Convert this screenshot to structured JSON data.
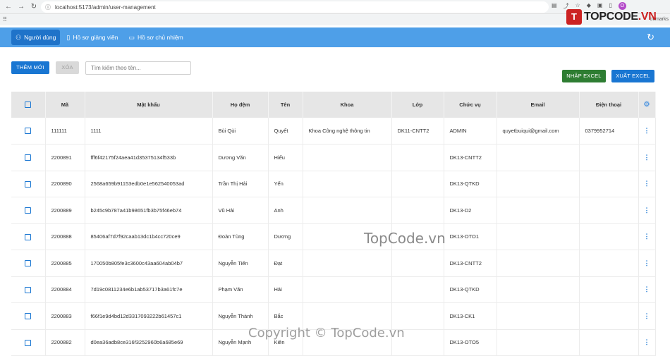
{
  "browser": {
    "url": "localhost:5173/admin/user-management",
    "bookmarks_label": "okmarks",
    "profile_initial": "O"
  },
  "logo": {
    "prefix": "T",
    "text": "TOPCODE",
    "suffix": ".VN"
  },
  "header": {
    "tabs": [
      {
        "label": "Người dùng",
        "icon": "users-icon",
        "active": true
      },
      {
        "label": "Hồ sơ giảng viên",
        "icon": "document-icon",
        "active": false
      },
      {
        "label": "Hồ sơ chủ nhiệm",
        "icon": "folder-icon",
        "active": false
      }
    ],
    "accent": "#4e9fe8"
  },
  "toolbar": {
    "add_label": "THÊM MỚI",
    "delete_label": "XÓA",
    "search_placeholder": "Tìm kiếm theo tên...",
    "import_label": "NHẬP EXCEL",
    "export_label": "XUẤT EXCEL"
  },
  "table": {
    "columns": [
      "Mã",
      "Mật khẩu",
      "Họ đệm",
      "Tên",
      "Khoa",
      "Lớp",
      "Chức vụ",
      "Email",
      "Điện thoại"
    ],
    "rows": [
      [
        "111111",
        "1111",
        "Bùi Qùi",
        "Quyết",
        "Khoa Công nghệ thông tin",
        "DK11-CNTT2",
        "ADMIN",
        "quyetbuiqui@gmail.com",
        "0379952714"
      ],
      [
        "2200891",
        "fff6f42175f24aea41d35375134f533b",
        "Dương Văn",
        "Hiếu",
        "",
        "",
        "DK13-CNTT2",
        "",
        ""
      ],
      [
        "2200890",
        "2568a659b91153edb0e1e562540053ad",
        "Trần Thị Hải",
        "Yến",
        "",
        "",
        "DK13-QTKD",
        "",
        ""
      ],
      [
        "2200889",
        "b245c9b787a41b98651fb3b75f46eb74",
        "Vũ Hải",
        "Anh",
        "",
        "",
        "DK13-D2",
        "",
        ""
      ],
      [
        "2200888",
        "85406af7d7f92caab13dc1b4cc720ce9",
        "Đoàn Tùng",
        "Dương",
        "",
        "",
        "DK13-OTO1",
        "",
        ""
      ],
      [
        "2200885",
        "170050b805fe3c3600c43aa604ab04b7",
        "Nguyễn Tiến",
        "Đạt",
        "",
        "",
        "DK13-CNTT2",
        "",
        ""
      ],
      [
        "2200884",
        "7d19c0811234e6b1ab53717b3a61fc7e",
        "Phạm Văn",
        "Hải",
        "",
        "",
        "DK13-QTKD",
        "",
        ""
      ],
      [
        "2200883",
        "f66f1e9d4bd12d3317093222b61457c1",
        "Nguyễn Thành",
        "Bắc",
        "",
        "",
        "DK13-CK1",
        "",
        ""
      ],
      [
        "2200882",
        "d0ea36adb8ce316f3252960b6a685e69",
        "Nguyễn Mạnh",
        "Kiên",
        "",
        "",
        "DK13-OTO5",
        "",
        ""
      ]
    ]
  },
  "watermarks": {
    "center": "TopCode.vn",
    "bottom": "Copyright © TopCode.vn"
  }
}
